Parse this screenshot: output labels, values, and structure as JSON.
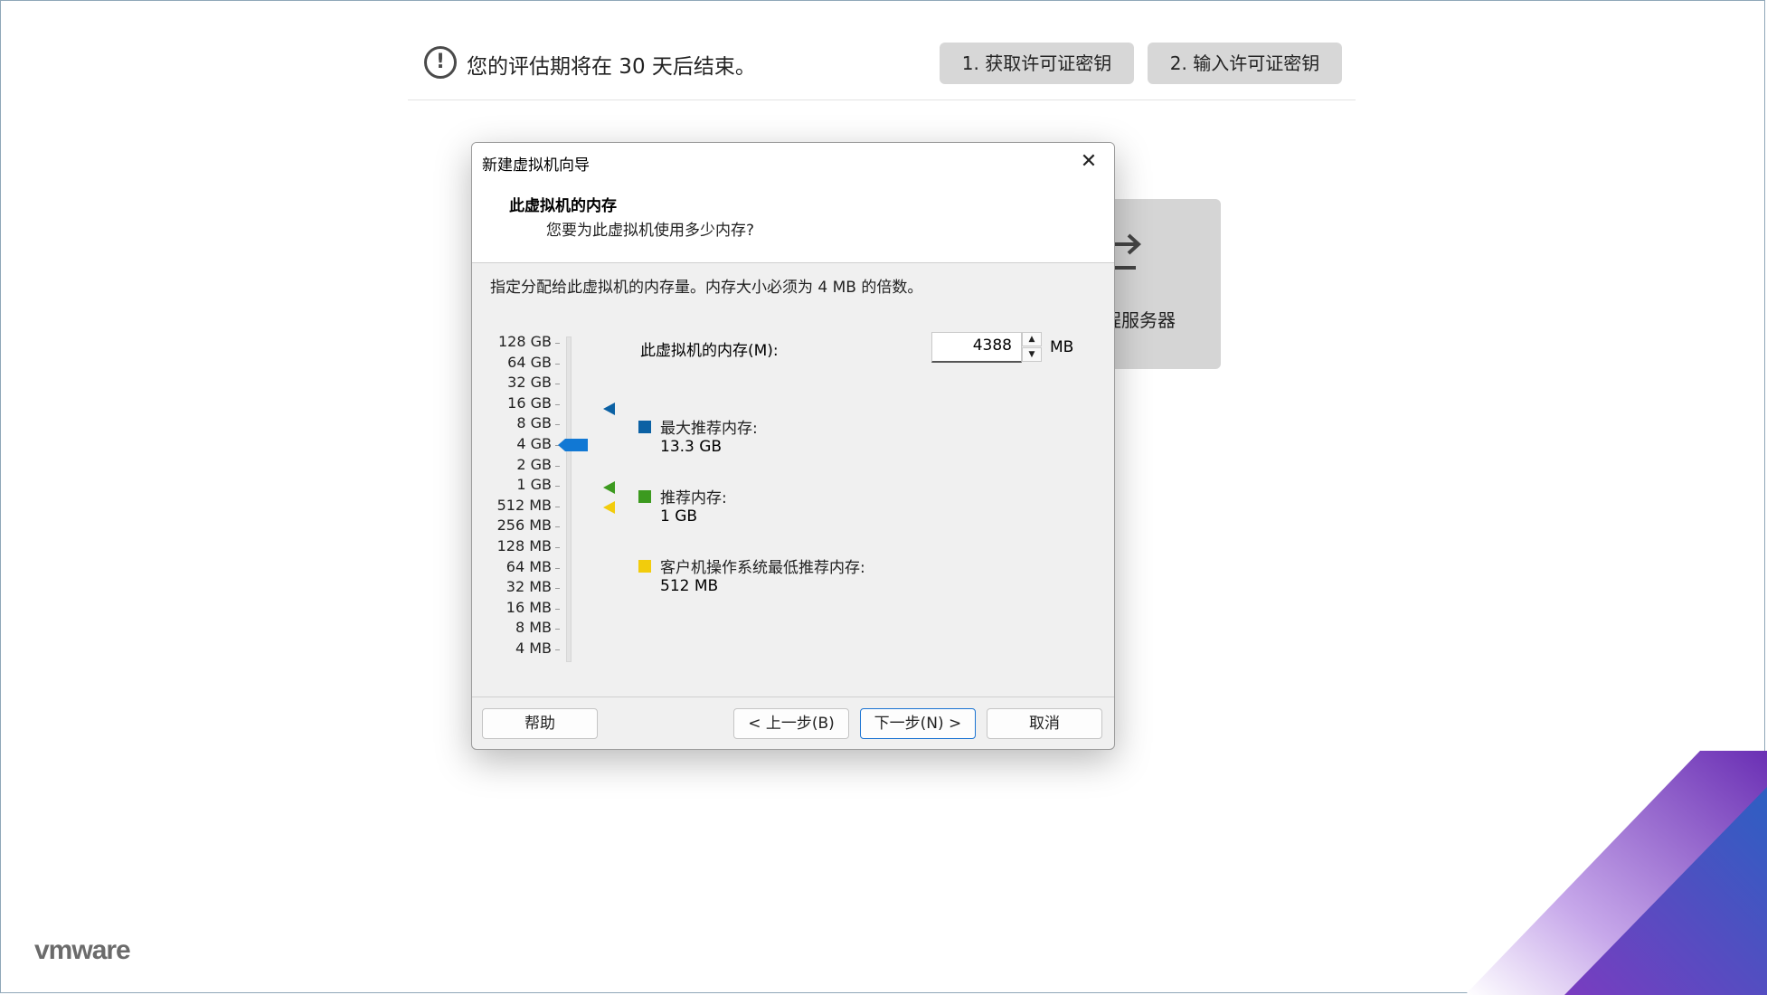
{
  "eval_bar": {
    "message": "您的评估期将在 30 天后结束。",
    "warn_icon": "exclamation-circle-icon",
    "button_get_license": "1. 获取许可证密钥",
    "button_enter_license": "2. 输入许可证密钥"
  },
  "bg_card": {
    "label": "程服务器",
    "icon": "connect-arrow-icon"
  },
  "dialog": {
    "title": "新建虚拟机向导",
    "close_icon": "close-icon",
    "heading": "此虚拟机的内存",
    "subheading": "您要为此虚拟机使用多少内存?",
    "description": "指定分配给此虚拟机的内存量。内存大小必须为 4 MB 的倍数。",
    "scale_labels": [
      "128 GB",
      "64 GB",
      "32 GB",
      "16 GB",
      "8 GB",
      "4 GB",
      "2 GB",
      "1 GB",
      "512 MB",
      "256 MB",
      "128 MB",
      "64 MB",
      "32 MB",
      "16 MB",
      "8 MB",
      "4 MB"
    ],
    "memory_label": "此虚拟机的内存(M):",
    "memory_value": "4388",
    "memory_unit": "MB",
    "legend": [
      {
        "title": "最大推荐内存:",
        "value": "13.3 GB",
        "color": "#0b61a4"
      },
      {
        "title": "推荐内存:",
        "value": "1 GB",
        "color": "#3c9a1f"
      },
      {
        "title": "客户机操作系统最低推荐内存:",
        "value": "512 MB",
        "color": "#f2cc0c"
      }
    ],
    "buttons": {
      "help": "帮助",
      "back": "< 上一步(B)",
      "next": "下一步(N) >",
      "cancel": "取消"
    }
  },
  "brand": {
    "logo_text": "vmware",
    "accent_colors": [
      "#6a2fb4",
      "#2d5fc2"
    ]
  }
}
